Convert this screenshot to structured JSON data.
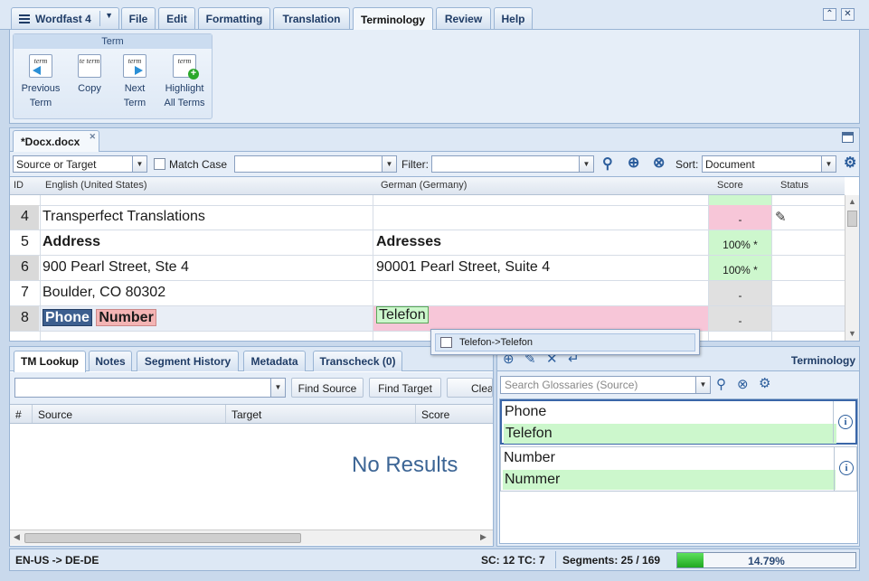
{
  "menu": {
    "app_label": "Wordfast 4",
    "tabs": [
      "File",
      "Edit",
      "Formatting",
      "Translation",
      "Terminology",
      "Review",
      "Help"
    ]
  },
  "ribbon": {
    "group_title": "Term",
    "buttons": [
      {
        "line1": "Previous",
        "line2": "Term"
      },
      {
        "line1": "Copy",
        "line2": ""
      },
      {
        "line1": "Next",
        "line2": "Term"
      },
      {
        "line1": "Highlight",
        "line2": "All Terms"
      }
    ]
  },
  "document": {
    "tab": "*Docx.docx"
  },
  "toolbar": {
    "scope_value": "Source or Target",
    "match_case": "Match Case",
    "filter_label": "Filter:",
    "sort_label": "Sort:",
    "sort_value": "Document"
  },
  "grid": {
    "headers": {
      "id": "ID",
      "source": "English (United States)",
      "target": "German (Germany)",
      "score": "Score",
      "status": "Status"
    },
    "rows": [
      {
        "id": "4",
        "source": "Transperfect Translations",
        "target": "",
        "score": "-"
      },
      {
        "id": "5",
        "source": "Address",
        "target": "Adresses",
        "score": "100% *"
      },
      {
        "id": "6",
        "source": "900 Pearl Street, Ste 4",
        "target": "90001 Pearl Street, Suite 4",
        "score": "100% *"
      },
      {
        "id": "7",
        "source": "Boulder, CO 80302",
        "target": "",
        "score": "-"
      },
      {
        "id": "8",
        "source_term1": "Phone",
        "source_term2": "Number",
        "target": "Telefon",
        "score": "-"
      }
    ]
  },
  "autocomplete": {
    "item": "Telefon->Telefon"
  },
  "lookup_panel": {
    "tabs": [
      "TM Lookup",
      "Notes",
      "Segment History",
      "Metadata",
      "Transcheck (0)"
    ],
    "find_source": "Find Source",
    "find_target": "Find Target",
    "clear": "Clear",
    "columns": [
      "#",
      "Source",
      "Target",
      "Score"
    ],
    "empty": "No Results"
  },
  "terminology_panel": {
    "title": "Terminology",
    "search_placeholder": "Search Glossaries (Source)",
    "entries": [
      {
        "source": "Phone",
        "target": "Telefon"
      },
      {
        "source": "Number",
        "target": "Nummer"
      }
    ]
  },
  "status": {
    "languages": "EN-US -> DE-DE",
    "sc_tc": "SC: 12 TC: 7",
    "segments": "Segments: 25 / 169",
    "progress_text": "14.79%",
    "progress_fraction": 0.1479
  }
}
